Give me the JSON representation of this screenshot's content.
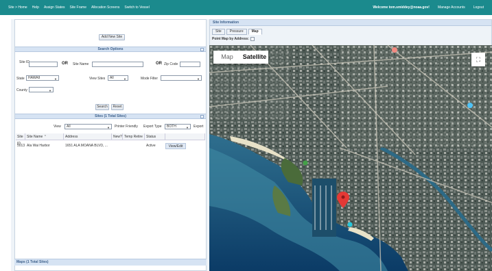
{
  "nav": {
    "links": [
      "Site > Home",
      "Help",
      "Assign States",
      "Site Frame",
      "Allocation Screens",
      "Switch to Vessel"
    ],
    "welcome": "Welcome tom.smiddey@noaa.gov!",
    "manage_accounts": "Manage Accounts",
    "logout": "Logout"
  },
  "left": {
    "add_new_site": "Add New Site",
    "search_options_title": "Search Options",
    "site_id_label": "Site ID",
    "or1": "OR",
    "site_name_label": "Site Name",
    "or2": "OR",
    "zip_label": "Zip Code",
    "state_label": "State",
    "state_value": "HAWAII",
    "view_sites_label": "View Sites",
    "view_sites_value": "All",
    "mode_filter_label": "Mode Filter",
    "county_label": "County",
    "search_btn": "Search",
    "reset_btn": "Reset",
    "sites_title": "Sites (1 Total Sites)",
    "view_label": "View",
    "view_value": "All",
    "printer_friendly": "Printer Friendly",
    "export_type_label": "Export Type",
    "export_type_value": "BOTH",
    "export_btn": "Export",
    "columns": [
      "Site ID",
      "Site Name ⌃",
      "Address",
      "New?",
      "Temp Retire",
      "Status",
      ""
    ],
    "rows": [
      {
        "site_id": "5013",
        "site_name": "Ala Wai Harbor",
        "address": "1651 ALA MOANA BLVD, ...",
        "new": "",
        "temp": "",
        "status": "Active",
        "action": "View/Edit"
      }
    ],
    "maps_title": "Maps (1 Total Sites)"
  },
  "right": {
    "panel_title": "Site Information",
    "tabs": [
      "Site",
      "Pressure",
      "Map"
    ],
    "point_map_label": "Point Map by Address:",
    "map_toggle": [
      "Map",
      "Satellite"
    ]
  }
}
